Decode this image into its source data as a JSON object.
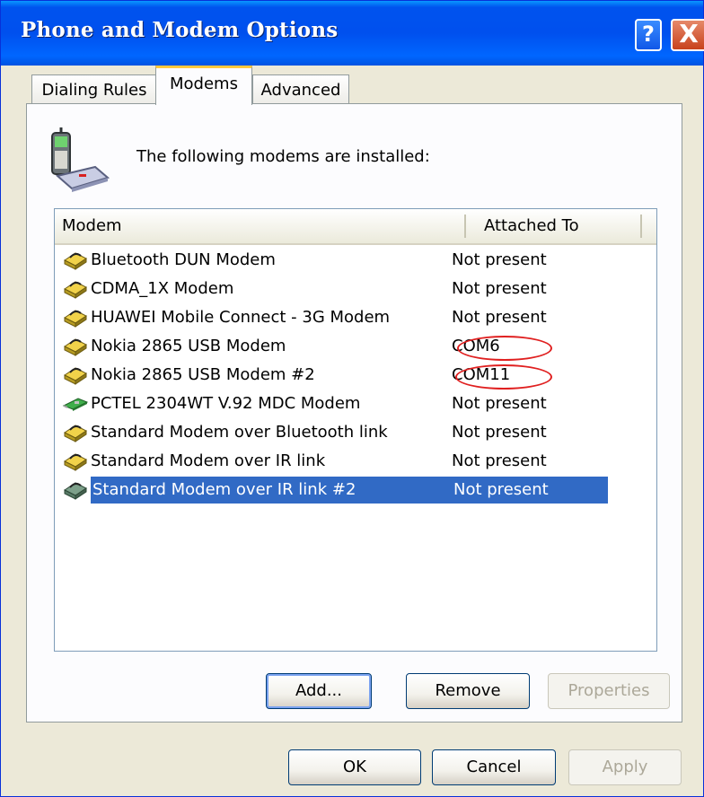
{
  "window": {
    "title": "Phone and Modem Options",
    "help_label": "?",
    "close_label": "X"
  },
  "tabs": [
    {
      "label": "Dialing Rules",
      "selected": false
    },
    {
      "label": "Modems",
      "selected": true
    },
    {
      "label": "Advanced",
      "selected": false
    }
  ],
  "modems_tab": {
    "installed_label": "The following modems are  installed:",
    "columns": {
      "modem": "Modem",
      "attached_to": "Attached To"
    },
    "rows": [
      {
        "name": "Bluetooth DUN Modem",
        "attached": "Not present",
        "icon": "modem-icon",
        "selected": false
      },
      {
        "name": "CDMA_1X Modem",
        "attached": "Not present",
        "icon": "modem-icon",
        "selected": false
      },
      {
        "name": "HUAWEI Mobile Connect - 3G Modem",
        "attached": "Not present",
        "icon": "modem-icon",
        "selected": false
      },
      {
        "name": "Nokia 2865 USB Modem",
        "attached": "COM6",
        "icon": "modem-icon",
        "selected": false
      },
      {
        "name": "Nokia 2865 USB Modem  #2",
        "attached": "COM11",
        "icon": "modem-icon",
        "selected": false
      },
      {
        "name": "PCTEL 2304WT V.92 MDC Modem",
        "attached": "Not present",
        "icon": "pci-modem-card-icon",
        "selected": false
      },
      {
        "name": "Standard Modem over Bluetooth link",
        "attached": "Not present",
        "icon": "modem-icon",
        "selected": false
      },
      {
        "name": "Standard Modem over IR link",
        "attached": "Not present",
        "icon": "modem-icon",
        "selected": false
      },
      {
        "name": "Standard Modem over IR link #2",
        "attached": "Not present",
        "icon": "modem-icon",
        "selected": true
      }
    ],
    "buttons": {
      "add": "Add...",
      "remove": "Remove",
      "properties": "Properties"
    }
  },
  "footer": {
    "ok": "OK",
    "cancel": "Cancel",
    "apply": "Apply"
  },
  "colors": {
    "title_bar": "#0053ee",
    "selection": "#316ac5",
    "annotation": "#e02020",
    "tab_highlight": "#ffc83c"
  }
}
